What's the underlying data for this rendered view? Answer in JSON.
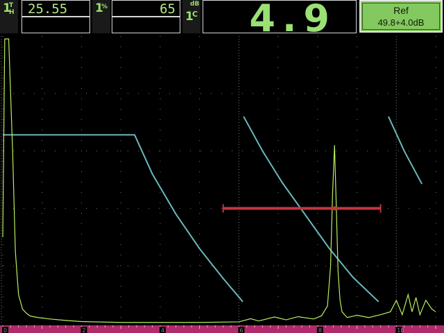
{
  "header": {
    "gate_t": {
      "icon_main": "1",
      "icon_sub": [
        "T",
        "H"
      ],
      "value": "25.55"
    },
    "gate_pct": {
      "icon_main": "1",
      "icon_sub": [
        "%"
      ],
      "value": "65"
    },
    "db_icon": {
      "icon_main": "1",
      "icon_sub": [
        "dB",
        "C"
      ]
    },
    "readout": "4.9",
    "ref": {
      "title": "Ref",
      "value": "49.8+4.0dB"
    }
  },
  "colors": {
    "echo": "#b9ef5e",
    "tcg_curve": "#6ab8bc",
    "gate_bar": "#c3363c",
    "grid": "#7a7a7a",
    "axis_band": "#b02b6a",
    "label_bg": "#1a1a1a"
  },
  "chart_data": {
    "type": "line",
    "x_range": [
      0,
      11
    ],
    "y_range": [
      0,
      100
    ],
    "x_tick_labels": [
      "0",
      "2",
      "4",
      "6",
      "8",
      "10"
    ],
    "x_tick_values": [
      0,
      2,
      4,
      6,
      8,
      10
    ],
    "grid": true,
    "series": [
      {
        "role": "tcg-curve",
        "segments": [
          [
            [
              0,
              65.6
            ],
            [
              3.35,
              65.6
            ],
            [
              3.8,
              52
            ],
            [
              4.4,
              38
            ],
            [
              5.0,
              26
            ],
            [
              5.6,
              15.6
            ],
            [
              6.1,
              7.5
            ]
          ],
          [
            [
              6.12,
              72
            ],
            [
              6.6,
              60
            ],
            [
              7.1,
              49
            ],
            [
              7.7,
              37.5
            ],
            [
              8.3,
              26
            ],
            [
              8.9,
              16
            ],
            [
              9.55,
              7.5
            ]
          ],
          [
            [
              9.8,
              72
            ],
            [
              10.2,
              60
            ],
            [
              10.65,
              48.5
            ]
          ]
        ]
      },
      {
        "role": "echo-signal",
        "points": [
          [
            0.0,
            30
          ],
          [
            0.05,
            99
          ],
          [
            0.15,
            99
          ],
          [
            0.25,
            60
          ],
          [
            0.32,
            25
          ],
          [
            0.4,
            10
          ],
          [
            0.5,
            5
          ],
          [
            0.6,
            3.5
          ],
          [
            0.7,
            2.5
          ],
          [
            0.9,
            2
          ],
          [
            1.2,
            1.5
          ],
          [
            1.6,
            1
          ],
          [
            2.0,
            0.6
          ],
          [
            3.0,
            0.3
          ],
          [
            5.0,
            0.3
          ],
          [
            6.0,
            0.5
          ],
          [
            6.3,
            1.6
          ],
          [
            6.5,
            0.8
          ],
          [
            6.9,
            2.2
          ],
          [
            7.2,
            1.2
          ],
          [
            7.5,
            2.3
          ],
          [
            7.9,
            1.5
          ],
          [
            8.1,
            2.6
          ],
          [
            8.25,
            6
          ],
          [
            8.33,
            20
          ],
          [
            8.38,
            45
          ],
          [
            8.43,
            62
          ],
          [
            8.48,
            38
          ],
          [
            8.52,
            18
          ],
          [
            8.57,
            8
          ],
          [
            8.62,
            4
          ],
          [
            8.75,
            2
          ],
          [
            9.0,
            2.8
          ],
          [
            9.3,
            2
          ],
          [
            9.6,
            3
          ],
          [
            9.85,
            4
          ],
          [
            10.0,
            8
          ],
          [
            10.15,
            3
          ],
          [
            10.3,
            10
          ],
          [
            10.4,
            4
          ],
          [
            10.5,
            9
          ],
          [
            10.6,
            3
          ],
          [
            10.75,
            8
          ],
          [
            10.9,
            5
          ],
          [
            11.0,
            4
          ]
        ]
      }
    ],
    "gate": {
      "start": 5.6,
      "end": 9.6,
      "level": 40,
      "crossing": 8.43
    }
  }
}
